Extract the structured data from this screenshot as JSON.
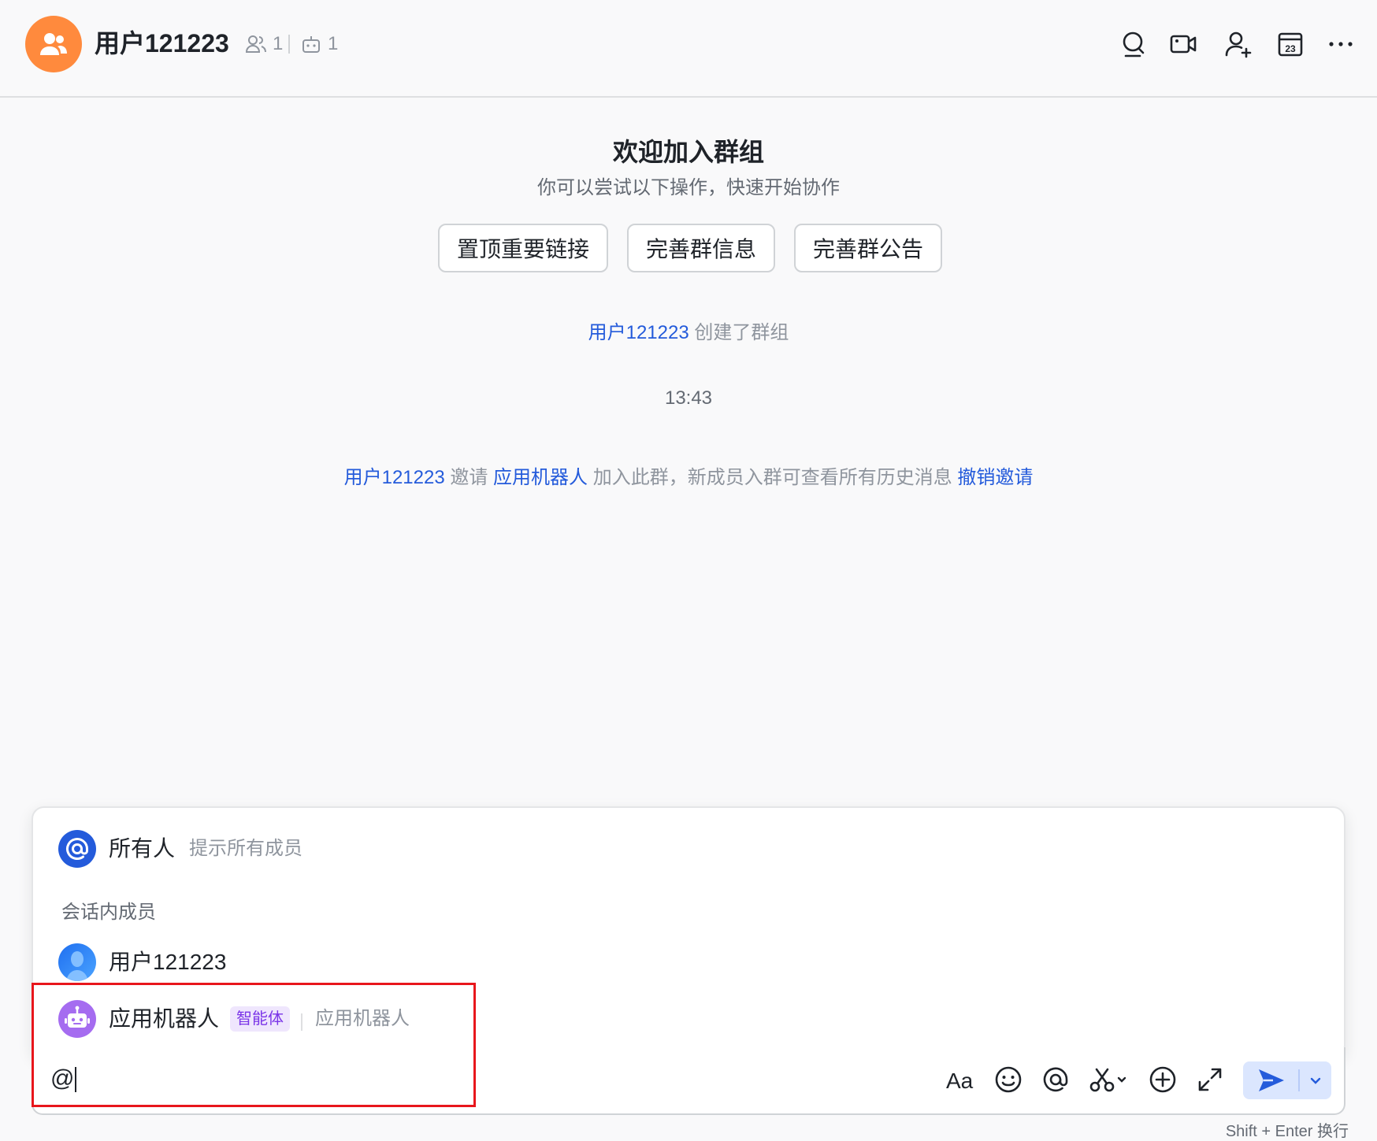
{
  "header": {
    "group_name": "用户121223",
    "member_count": "1",
    "bot_count": "1",
    "actions": [
      "search-icon",
      "video-call-icon",
      "add-member-icon",
      "calendar-icon",
      "more-icon"
    ],
    "calendar_day": "23"
  },
  "welcome": {
    "title": "欢迎加入群组",
    "subtitle": "你可以尝试以下操作，快速开始协作",
    "buttons": [
      "置顶重要链接",
      "完善群信息",
      "完善群公告"
    ]
  },
  "messages": {
    "created_user": "用户121223",
    "created_text": "创建了群组",
    "time": "13:43",
    "invite_user": "用户121223",
    "invite_verb": "邀请",
    "invite_target": "应用机器人",
    "invite_text": "加入此群，新成员入群可查看所有历史消息",
    "revoke_link": "撤销邀请"
  },
  "mention_popup": {
    "everyone_name": "所有人",
    "everyone_desc": "提示所有成员",
    "section_label": "会话内成员",
    "members": [
      {
        "name": "用户121223"
      },
      {
        "name": "应用机器人",
        "tag": "智能体",
        "desc": "应用机器人"
      }
    ]
  },
  "composer": {
    "input_value": "@",
    "toolbar": [
      "text-format-icon",
      "emoji-icon",
      "mention-icon",
      "screenshot-icon",
      "plus-icon",
      "expand-icon"
    ],
    "format_glyph": "Aa",
    "send_hint": "Shift + Enter 换行"
  },
  "colors": {
    "accent": "#245bdb",
    "group_avatar": "#ff8a3d",
    "agent_tag": "#7b35e8",
    "highlight": "#e8161c"
  }
}
